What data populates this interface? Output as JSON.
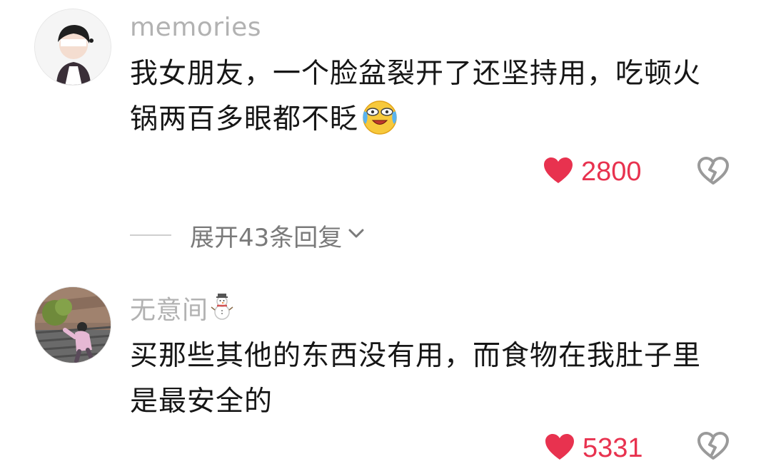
{
  "comments": [
    {
      "username": "memories",
      "text": "我女朋友，一个脸盆裂开了还坚持用，吃顿火锅两百多眼都不眨",
      "emoji": "crying-laughing-emoji",
      "likes": "2800"
    },
    {
      "username": "无意间",
      "username_icon": "snowman-icon",
      "text": "买那些其他的东西没有用，而食物在我肚子里是最安全的",
      "likes": "5331"
    }
  ],
  "expand_replies": {
    "label": "展开43条回复",
    "icon": "chevron-down-icon"
  },
  "colors": {
    "like": "#e8324f",
    "username": "#b2b2b2",
    "text": "#161616",
    "secondary": "#7a7a7a"
  }
}
